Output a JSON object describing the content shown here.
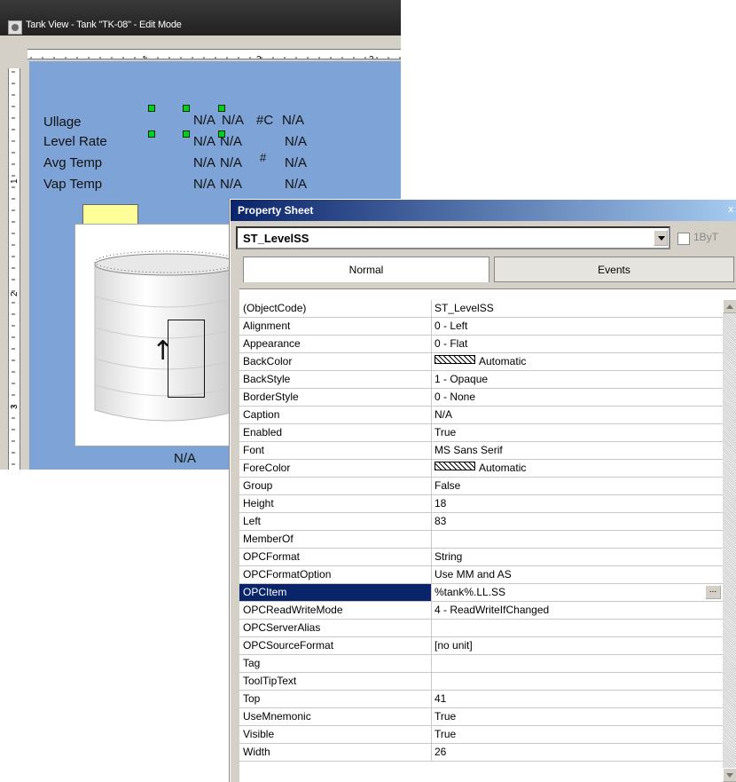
{
  "tank_view": {
    "title": "Tank View - Tank \"TK-08\" - Edit Mode",
    "ruler": {
      "marks": [
        "1",
        "2",
        "3"
      ]
    },
    "labels": [
      {
        "name": "Ullage",
        "value1": "N/A",
        "value2": "N/A",
        "unit": "#C",
        "value3": "N/A"
      },
      {
        "name": "Level Rate",
        "value1": "N/A",
        "value2": "N/A",
        "unit": "",
        "value3": "N/A"
      },
      {
        "name": "Avg Temp",
        "value1": "N/A",
        "value2": "N/A",
        "unit": "#",
        "value3": "N/A"
      },
      {
        "name": "Vap Temp",
        "value1": "N/A",
        "value2": "N/A",
        "unit": "",
        "value3": "N/A"
      }
    ],
    "tank_bottom_value": "N/A",
    "level_arrow_icon": "arrow-up-icon"
  },
  "property_sheet": {
    "title": "Property Sheet",
    "close_icon": "close-icon",
    "object_select": "ST_LevelSS",
    "one_by_one_label": "1ByT",
    "tabs": [
      {
        "label": "Normal",
        "active": true
      },
      {
        "label": "Events",
        "active": false
      }
    ],
    "properties": [
      {
        "name": "(ObjectCode)",
        "value": "ST_LevelSS"
      },
      {
        "name": "Alignment",
        "value": "0 - Left"
      },
      {
        "name": "Appearance",
        "value": "0 - Flat"
      },
      {
        "name": "BackColor",
        "value": "Automatic",
        "swatch": true
      },
      {
        "name": "BackStyle",
        "value": "1 - Opaque"
      },
      {
        "name": "BorderStyle",
        "value": "0 - None"
      },
      {
        "name": "Caption",
        "value": "N/A"
      },
      {
        "name": "Enabled",
        "value": "True"
      },
      {
        "name": "Font",
        "value": "MS Sans Serif"
      },
      {
        "name": "ForeColor",
        "value": "Automatic",
        "swatch": true
      },
      {
        "name": "Group",
        "value": "False"
      },
      {
        "name": "Height",
        "value": "18"
      },
      {
        "name": "Left",
        "value": "83"
      },
      {
        "name": "MemberOf",
        "value": ""
      },
      {
        "name": "OPCFormat",
        "value": "String"
      },
      {
        "name": "OPCFormatOption",
        "value": "Use MM and AS"
      },
      {
        "name": "OPCItem",
        "value": "%tank%.LL.SS",
        "selected": true,
        "button": "..."
      },
      {
        "name": "OPCReadWriteMode",
        "value": "4 - ReadWriteIfChanged"
      },
      {
        "name": "OPCServerAlias",
        "value": ""
      },
      {
        "name": "OPCSourceFormat",
        "value": "[no unit]"
      },
      {
        "name": "Tag",
        "value": ""
      },
      {
        "name": "ToolTipText",
        "value": ""
      },
      {
        "name": "Top",
        "value": "41"
      },
      {
        "name": "UseMnemonic",
        "value": "True"
      },
      {
        "name": "Visible",
        "value": "True"
      },
      {
        "name": "Width",
        "value": "26"
      }
    ]
  },
  "colors": {
    "canvas": "#7ea3d6",
    "selection": "#0a246a",
    "handle": "#00d020"
  }
}
